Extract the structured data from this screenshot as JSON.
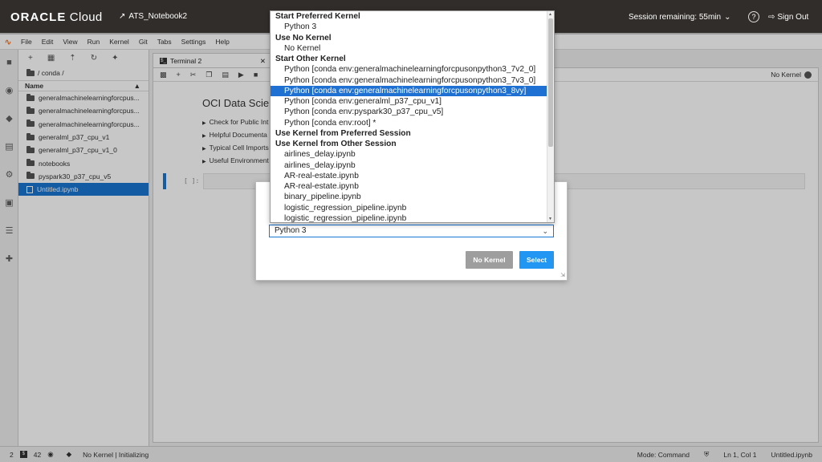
{
  "oci_bar": {
    "brand_bold": "ORACLE",
    "brand_rest": " Cloud",
    "notebook_name": "ATS_Notebook2",
    "session_text": "Session remaining: 55min",
    "help_label": "?",
    "signout_label": "Sign Out"
  },
  "menubar": {
    "items": [
      "File",
      "Edit",
      "View",
      "Run",
      "Kernel",
      "Git",
      "Tabs",
      "Settings",
      "Help"
    ]
  },
  "filebrowser": {
    "path": "/ conda /",
    "column_name": "Name",
    "rows": [
      {
        "name": "generalmachinelearningforcpus..."
      },
      {
        "name": "generalmachinelearningforcpus..."
      },
      {
        "name": "generalmachinelearningforcpus..."
      },
      {
        "name": "generalml_p37_cpu_v1"
      },
      {
        "name": "generalml_p37_cpu_v1_0"
      },
      {
        "name": "notebooks"
      },
      {
        "name": "pyspark30_p37_cpu_v5"
      },
      {
        "name": "Untitled.ipynb"
      }
    ]
  },
  "tabs": {
    "terminal": "Terminal 2"
  },
  "notebook": {
    "kernel_status": "No Kernel",
    "title": "OCI Data Scie",
    "links": [
      "Check for Public Int",
      "Helpful Documenta",
      "Typical Cell Imports",
      "Useful Environment"
    ],
    "cell_prompt": "[ ]:"
  },
  "statusbar": {
    "count1": "2",
    "count2": "42",
    "kernel_state": "No Kernel | Initializing",
    "mode": "Mode: Command",
    "position": "Ln 1, Col 1",
    "filename": "Untitled.ipynb"
  },
  "dialog": {
    "selected_kernel": "Python 3",
    "no_kernel_button": "No Kernel",
    "select_button": "Select"
  },
  "dropdown": {
    "items": [
      {
        "text": "Start Preferred Kernel",
        "kind": "hdr"
      },
      {
        "text": "Python 3",
        "kind": "opt"
      },
      {
        "text": "Use No Kernel",
        "kind": "hdr"
      },
      {
        "text": "No Kernel",
        "kind": "opt"
      },
      {
        "text": "Start Other Kernel",
        "kind": "hdr"
      },
      {
        "text": "Python [conda env:generalmachinelearningforcpusonpython3_7v2_0]",
        "kind": "opt"
      },
      {
        "text": "Python [conda env:generalmachinelearningforcpusonpython3_7v3_0]",
        "kind": "opt"
      },
      {
        "text": "Python [conda env:generalmachinelearningforcpusonpython3_8vy]",
        "kind": "opt",
        "selected": true
      },
      {
        "text": "Python [conda env:generalml_p37_cpu_v1]",
        "kind": "opt"
      },
      {
        "text": "Python [conda env:pyspark30_p37_cpu_v5]",
        "kind": "opt"
      },
      {
        "text": "Python [conda env:root] *",
        "kind": "opt"
      },
      {
        "text": "Use Kernel from Preferred Session",
        "kind": "hdr"
      },
      {
        "text": "Use Kernel from Other Session",
        "kind": "hdr"
      },
      {
        "text": "airlines_delay.ipynb",
        "kind": "opt"
      },
      {
        "text": "airlines_delay.ipynb",
        "kind": "opt"
      },
      {
        "text": "AR-real-estate.ipynb",
        "kind": "opt"
      },
      {
        "text": "AR-real-estate.ipynb",
        "kind": "opt"
      },
      {
        "text": "binary_pipeline.ipynb",
        "kind": "opt"
      },
      {
        "text": "logistic_regression_pipeline.ipynb",
        "kind": "opt"
      },
      {
        "text": "logistic_regression_pipeline.ipynb",
        "kind": "opt"
      }
    ]
  }
}
